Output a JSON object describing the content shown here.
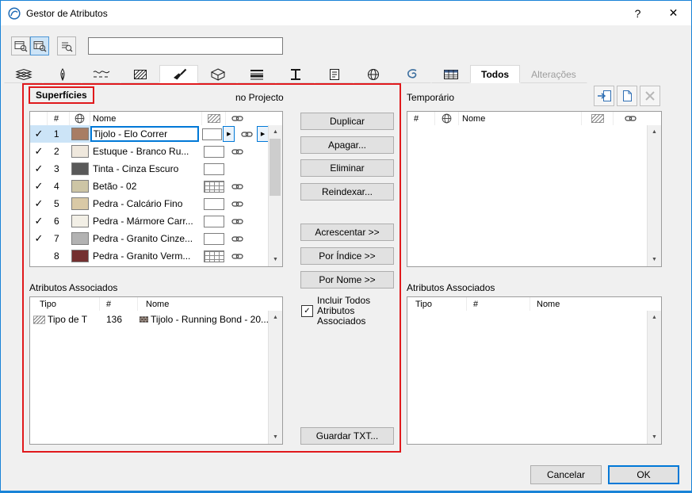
{
  "window": {
    "title": "Gestor de Atributos",
    "help_label": "?",
    "close_label": "✕"
  },
  "filter": {
    "value": ""
  },
  "icons": {
    "check": "✓",
    "dropdown": "▶",
    "scroll_up": "▲",
    "scroll_down": "▼"
  },
  "scope_tabs": {
    "todos": "Todos",
    "alteracoes": "Alterações"
  },
  "colors": {
    "accent": "#0078d7",
    "annotation": "#e0191c",
    "selection": "#cce4f7"
  },
  "left": {
    "title": "Superfícies",
    "scope_label": "no Projecto",
    "headers": {
      "num": "#",
      "nome": "Nome"
    },
    "rows": [
      {
        "check": "✓",
        "num": "1",
        "color": "#a87d64",
        "name": "Tijolo - Elo Correr"
      },
      {
        "check": "✓",
        "num": "2",
        "color": "#efe8dd",
        "name": "Estuque - Branco Ru..."
      },
      {
        "check": "✓",
        "num": "3",
        "color": "#595959",
        "name": "Tinta - Cinza Escuro"
      },
      {
        "check": "✓",
        "num": "4",
        "color": "#cdc5a5",
        "name": "Betão - 02"
      },
      {
        "check": "✓",
        "num": "5",
        "color": "#d9c9a6",
        "name": "Pedra - Calcário Fino"
      },
      {
        "check": "✓",
        "num": "6",
        "color": "#f2efe6",
        "name": "Pedra - Mármore Carr..."
      },
      {
        "check": "✓",
        "num": "7",
        "color": "#b2b2b2",
        "name": "Pedra - Granito Cinze..."
      },
      {
        "check": "",
        "num": "8",
        "color": "#743030",
        "name": "Pedra - Granito Verm..."
      }
    ],
    "assoc": {
      "title": "Atributos Associados",
      "headers": {
        "tipo": "Tipo",
        "num": "#",
        "nome": "Nome"
      },
      "rows": [
        {
          "tipo": "Tipo de T",
          "num": "136",
          "nome": "Tijolo - Running Bond - 20..."
        }
      ]
    }
  },
  "actions": {
    "duplicar": "Duplicar",
    "apagar": "Apagar...",
    "eliminar": "Eliminar",
    "reindexar": "Reindexar...",
    "acrescentar": "Acrescentar >>",
    "por_indice": "Por Índice >>",
    "por_nome": "Por Nome >>",
    "incluir_label": "Incluir Todos Atributos Associados",
    "guardar": "Guardar TXT..."
  },
  "right": {
    "title": "Temporário",
    "headers": {
      "num": "#",
      "nome": "Nome"
    },
    "assoc": {
      "title": "Atributos Associados",
      "headers": {
        "tipo": "Tipo",
        "num": "#",
        "nome": "Nome"
      }
    }
  },
  "footer": {
    "cancelar": "Cancelar",
    "ok": "OK"
  }
}
